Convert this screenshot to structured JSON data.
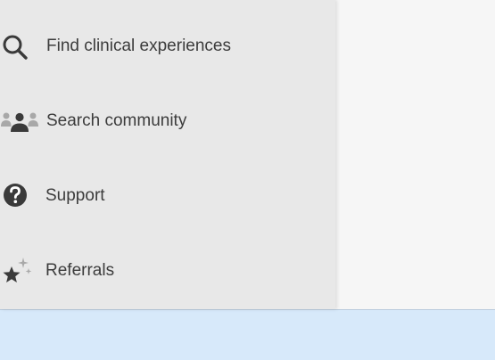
{
  "sidebar": {
    "items": [
      {
        "label": "Find clinical experiences",
        "icon": "search-icon"
      },
      {
        "label": "Search community",
        "icon": "community-icon"
      },
      {
        "label": "Support",
        "icon": "help-icon"
      },
      {
        "label": "Referrals",
        "icon": "star-sparkle-icon"
      }
    ]
  },
  "colors": {
    "sidebar_bg": "#e8e8e8",
    "main_bg": "#f6f6f6",
    "bottom_bar_bg": "#d7e9fa",
    "text": "#3c3c3c",
    "icon": "#3a3a3a"
  }
}
